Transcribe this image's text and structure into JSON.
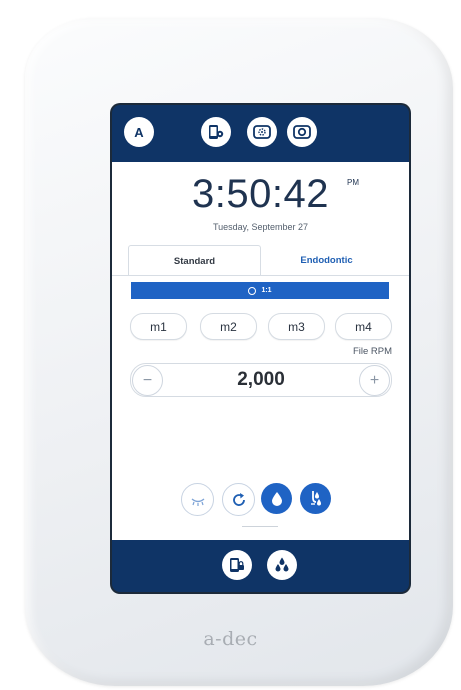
{
  "device": {
    "brand": "a-dec"
  },
  "topbar": {
    "avatar_letter": "A",
    "buttons": [
      {
        "icon": "tablet-settings-icon"
      },
      {
        "icon": "light-dim-icon"
      },
      {
        "icon": "light-icon"
      }
    ]
  },
  "clock": {
    "time": "3:50:42",
    "ampm": "PM",
    "date": "Tuesday, September 27"
  },
  "tabs": [
    {
      "label": "Standard",
      "active": true
    },
    {
      "label": "Endodontic",
      "active": false
    }
  ],
  "ratio": {
    "label": "1:1"
  },
  "memory_buttons": [
    "m1",
    "m2",
    "m3",
    "m4"
  ],
  "rpm": {
    "label": "File RPM",
    "value": "2,000",
    "decrement": "−",
    "increment": "+"
  },
  "controls": [
    {
      "icon": "light-off-icon",
      "active": false
    },
    {
      "icon": "rotation-icon",
      "active": false
    },
    {
      "icon": "water-drop-icon",
      "active": true
    },
    {
      "icon": "air-water-icon",
      "active": true
    }
  ],
  "bottombar": {
    "buttons": [
      {
        "icon": "tablet-lock-icon"
      },
      {
        "icon": "water-drops-icon"
      }
    ]
  },
  "colors": {
    "navy": "#0f3466",
    "accent_blue": "#1f63c4",
    "link_blue": "#1f5fb3",
    "housing": "#eef0f3"
  }
}
